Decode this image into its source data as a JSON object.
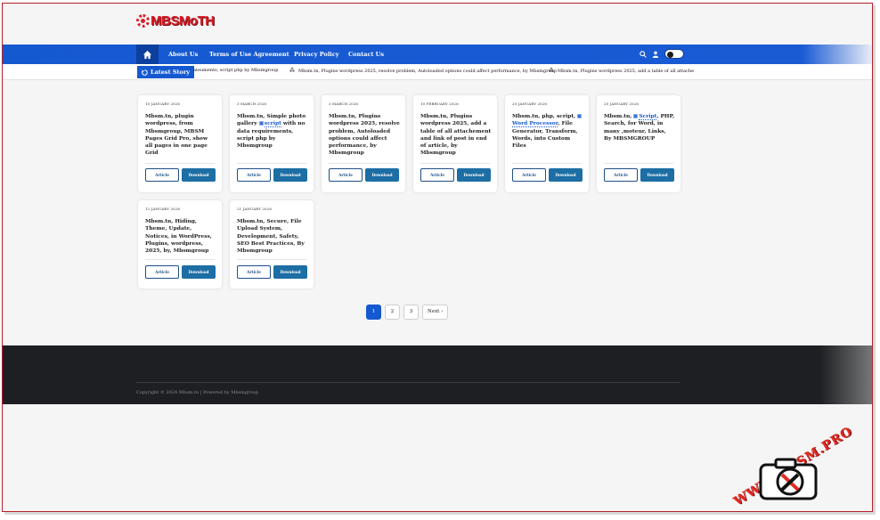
{
  "site": {
    "logo_text": "MBSMoTH"
  },
  "nav": {
    "items": [
      "About Us",
      "Terms of Use Agreement",
      "Privacy Policy",
      "Contact Us"
    ]
  },
  "ticker": {
    "label": "Latest Story",
    "items": [
      "ateuments, script php by Mbsmgroup",
      "Mbsm.tn, Plugins wordpress 2025, resolve problem, Autoloaded options could affect performance, by Mbsmgroup",
      "Mbsm.tn, Plugins wordpress 2025, add a table of all attache"
    ]
  },
  "buttons": {
    "article": "Article",
    "download": "Download"
  },
  "cards": [
    {
      "date": "10 JANUARY 2026",
      "title_parts": [
        {
          "t": "Mbsm.tn, plugin wordpress, from Mbsmgroup, MBSM Pages Grid Pro, show all pages in one page Grid"
        }
      ]
    },
    {
      "date": "3 MARCH 2026",
      "title_parts": [
        {
          "t": "Mbsm.tn, Simple photo gallery "
        },
        {
          "t": "script",
          "hl": true
        },
        {
          "t": " with no data requirements, script php by Mbsmgroup"
        }
      ]
    },
    {
      "date": "3 MARCH 2026",
      "title_parts": [
        {
          "t": "Mbsm.tn, Plugins wordpress 2025, resolve problem, Autoloaded options could affect performance, by Mbsmgroup"
        }
      ]
    },
    {
      "date": "10 FEBRUARY 2026",
      "title_parts": [
        {
          "t": "Mbsm.tn, Plugins wordpress 2025, add a table of all attachement and link of post in end of article, by Mbsmgroup"
        }
      ]
    },
    {
      "date": "20 JANUARY 2026",
      "title_parts": [
        {
          "t": "Mbsm.tn, php, script, "
        },
        {
          "t": "Word Processor",
          "hl": true
        },
        {
          "t": ", File Generator, Transform, Words, into Custom Files"
        }
      ]
    },
    {
      "date": "20 JANUARY 2026",
      "title_parts": [
        {
          "t": "Mbsm.tn, "
        },
        {
          "t": "Script",
          "hl": true
        },
        {
          "t": ", PHP, Search, for Word, in many ,moteur, Links, By MBSMGROUP"
        }
      ]
    },
    {
      "date": "12 JANUARY 2026",
      "title_parts": [
        {
          "t": "Mbsm.tn, Hiding, Theme, Update, Notices, in WordPress, Plugins, wordpress, 2025, by, Mbsmgroup"
        }
      ]
    },
    {
      "date": "21 JANUARY 2026",
      "title_parts": [
        {
          "t": "Mbsm.tn, Secure, File Upload System, Development, Safety, SEO Best Practices, By Mbsmgroup"
        }
      ]
    }
  ],
  "pagination": {
    "pages": [
      "1",
      "2",
      "3"
    ],
    "active": "1",
    "next": "Next ›"
  },
  "footer": {
    "copyright": "Copyright © 2024 Mbsm.tn | Powered by Mbsmgroup"
  },
  "watermark": {
    "text": "WWW.MBSM.PRO"
  },
  "colors": {
    "nav_blue": "#1559d1",
    "button_blue": "#1c6ea4",
    "footer_dark": "#1d1f23",
    "brand_red": "#d6202a"
  }
}
